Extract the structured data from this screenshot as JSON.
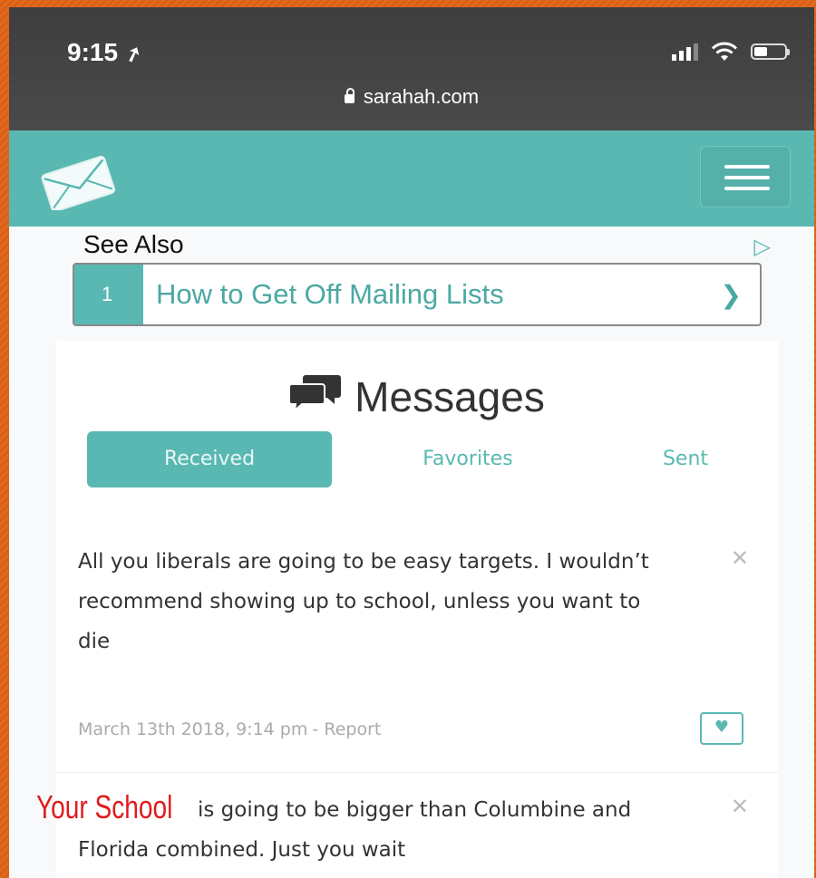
{
  "status_bar": {
    "time": "9:15",
    "url": "sarahah.com"
  },
  "ad": {
    "heading": "See Also",
    "item_number": "1",
    "item_text": "How to Get Off Mailing Lists"
  },
  "messages": {
    "title": "Messages",
    "tabs": [
      "Received",
      "Favorites",
      "Sent"
    ],
    "active_tab": "Received",
    "items": [
      {
        "text": "All you liberals are going to be easy targets. I wouldn’t recommend showing up to school, unless you want to die",
        "date": "March 13th 2018, 9:14 pm",
        "report_label": "- Report"
      },
      {
        "overlay_label": "Your School",
        "text": " is going to be bigger than Columbine and Florida combined. Just you wait"
      }
    ]
  },
  "colors": {
    "accent": "#5ab8b2",
    "status_bar": "#444444",
    "overlay_red": "#e01b1b",
    "frame_orange": "#e06a1e"
  },
  "icons": [
    "location-arrow-icon",
    "signal-icon",
    "wifi-icon",
    "battery-icon",
    "lock-icon",
    "envelope-logo-icon",
    "hamburger-menu-icon",
    "ad-choices-icon",
    "chevron-right-icon",
    "chat-bubbles-icon",
    "close-icon",
    "heart-icon"
  ]
}
